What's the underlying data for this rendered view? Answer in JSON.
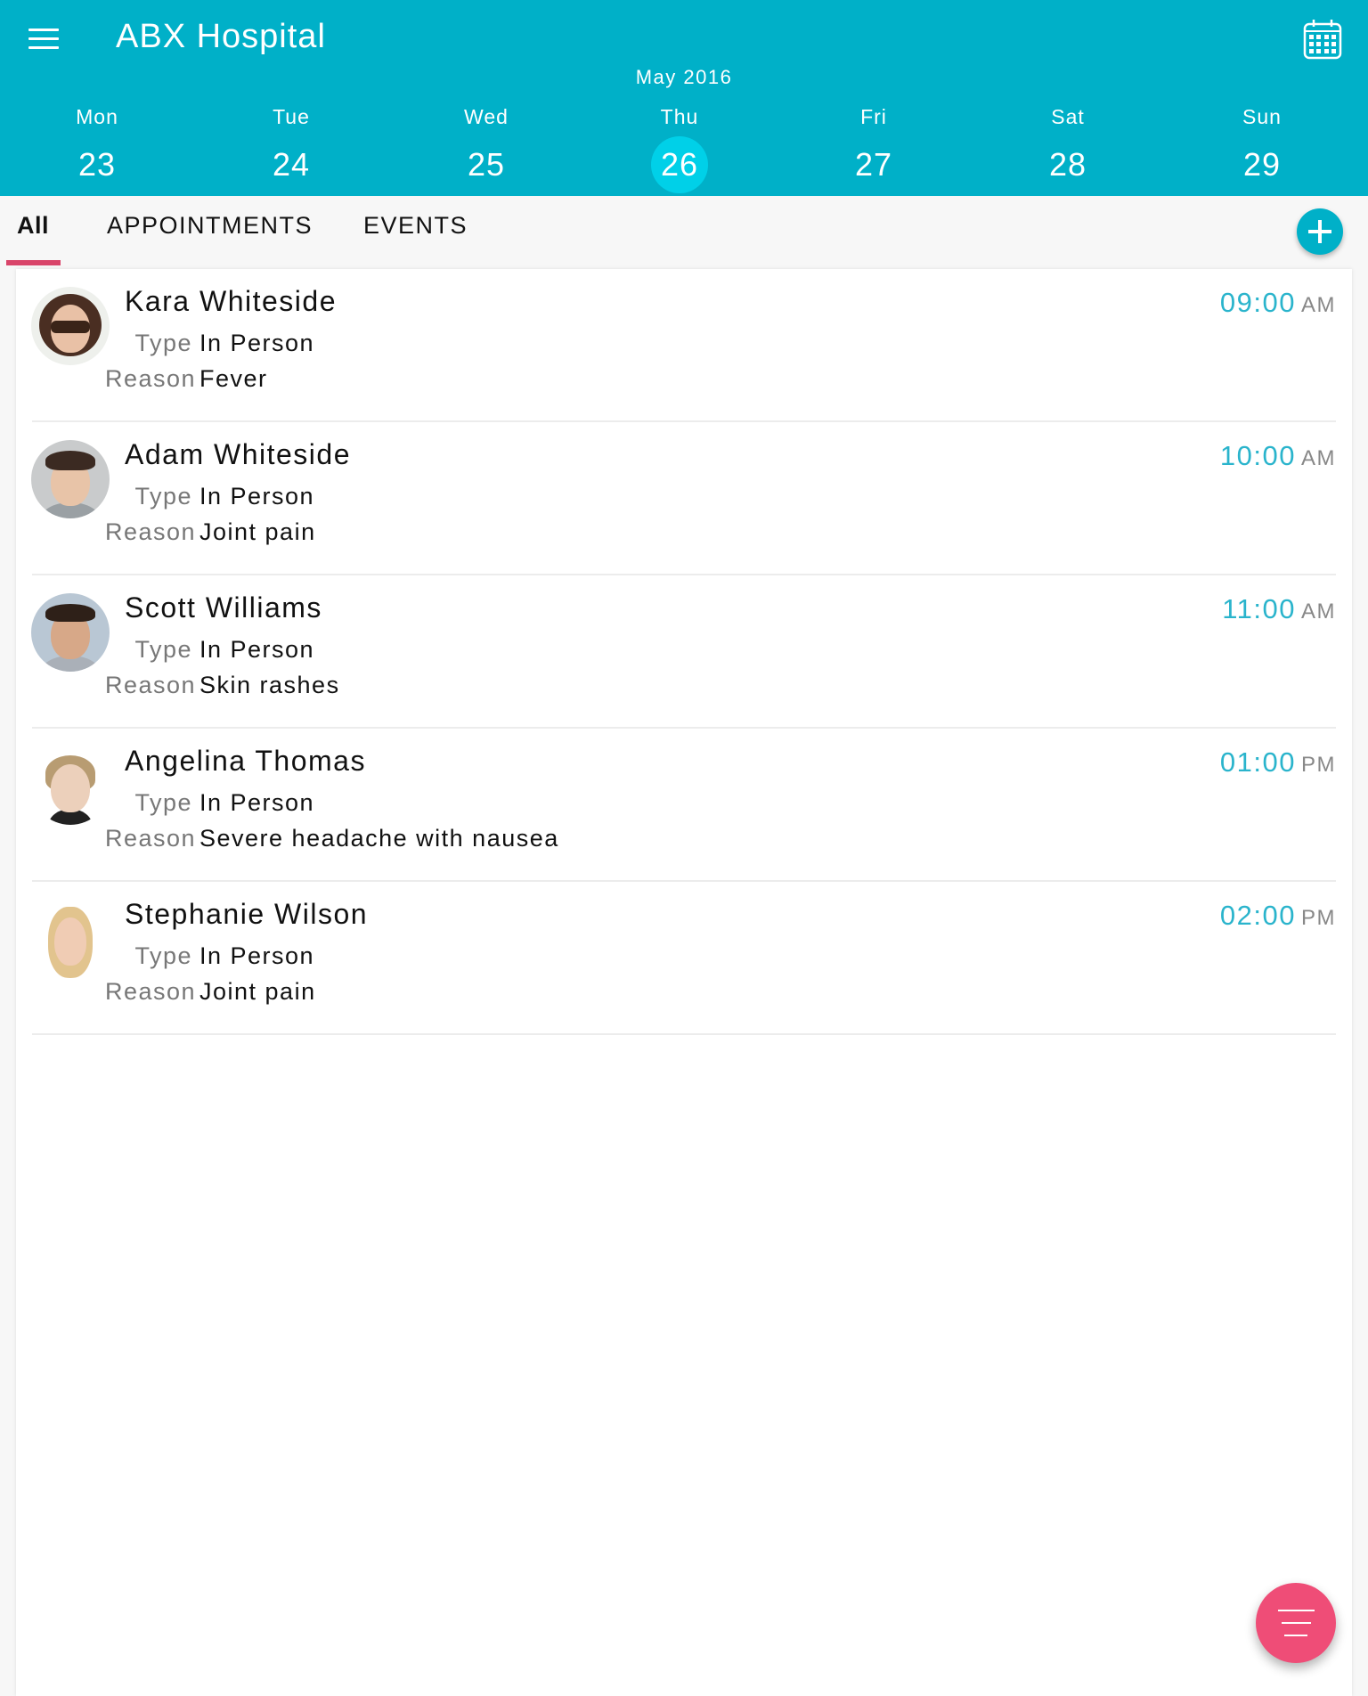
{
  "header": {
    "title": "ABX Hospital",
    "menu_icon": "hamburger-menu-icon",
    "calendar_icon": "calendar-icon",
    "month": "May 2016",
    "days": [
      {
        "name": "Mon",
        "num": "23",
        "selected": false
      },
      {
        "name": "Tue",
        "num": "24",
        "selected": false
      },
      {
        "name": "Wed",
        "num": "25",
        "selected": false
      },
      {
        "name": "Thu",
        "num": "26",
        "selected": true
      },
      {
        "name": "Fri",
        "num": "27",
        "selected": false
      },
      {
        "name": "Sat",
        "num": "28",
        "selected": false
      },
      {
        "name": "Sun",
        "num": "29",
        "selected": false
      }
    ]
  },
  "tabs": [
    {
      "label": "All",
      "active": true
    },
    {
      "label": "APPOINTMENTS",
      "active": false
    },
    {
      "label": "EVENTS",
      "active": false
    }
  ],
  "add_button_icon": "plus-icon",
  "labels": {
    "type": "Type",
    "reason": "Reason"
  },
  "appointments": [
    {
      "name": "Kara Whiteside",
      "type": "In Person",
      "reason": "Fever",
      "time": "09:00",
      "ampm": "AM"
    },
    {
      "name": "Adam Whiteside",
      "type": "In Person",
      "reason": "Joint pain",
      "time": "10:00",
      "ampm": "AM"
    },
    {
      "name": "Scott Williams",
      "type": "In Person",
      "reason": "Skin rashes",
      "time": "11:00",
      "ampm": "AM"
    },
    {
      "name": "Angelina Thomas",
      "type": "In Person",
      "reason": "Severe headache with nausea",
      "time": "01:00",
      "ampm": "PM"
    },
    {
      "name": "Stephanie Wilson",
      "type": "In Person",
      "reason": "Joint pain",
      "time": "02:00",
      "ampm": "PM"
    }
  ],
  "fab_icon": "filter-menu-icon",
  "colors": {
    "primary": "#00b0c8",
    "selected_day": "#00d0e8",
    "tab_indicator": "#d9456a",
    "fab": "#ef4d77",
    "time": "#2ab4cc"
  }
}
